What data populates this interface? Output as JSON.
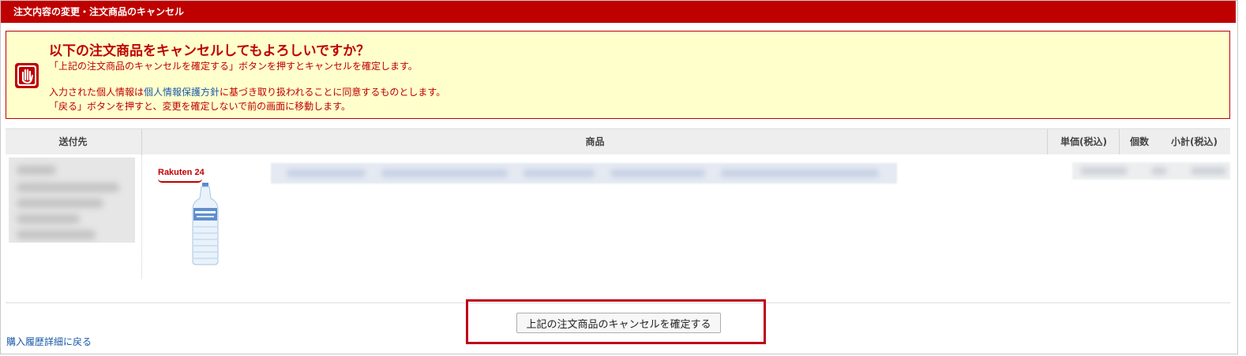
{
  "header": {
    "title": "注文内容の変更・注文商品のキャンセル"
  },
  "warning": {
    "heading": "以下の注文商品をキャンセルしてもよろしいですか？",
    "line1": "「上記の注文商品のキャンセルを確定する」ボタンを押すとキャンセルを確定します。",
    "line2_before": "入力された個人情報は",
    "line2_link": "個人情報保護方針",
    "line2_after": "に基づき取り扱われることに同意するものとします。",
    "line3": "「戻る」ボタンを押すと、変更を確定しないで前の画面に移動します。",
    "icon": "stop-hand-icon",
    "accent_color": "#bf0000",
    "background_color": "#ffffcc"
  },
  "table": {
    "columns": {
      "destination": "送付先",
      "product": "商品",
      "unit_price": "単価(税込)",
      "quantity": "個数",
      "subtotal": "小計(税込)"
    },
    "row": {
      "shop_logo": "Rakuten 24",
      "product_image": "water-bottle-image"
    }
  },
  "actions": {
    "confirm_label": "上記の注文商品のキャンセルを確定する",
    "back_label": "購入履歴詳細に戻る"
  },
  "colors": {
    "brand": "#bf0000",
    "link": "#1a5aa8"
  }
}
